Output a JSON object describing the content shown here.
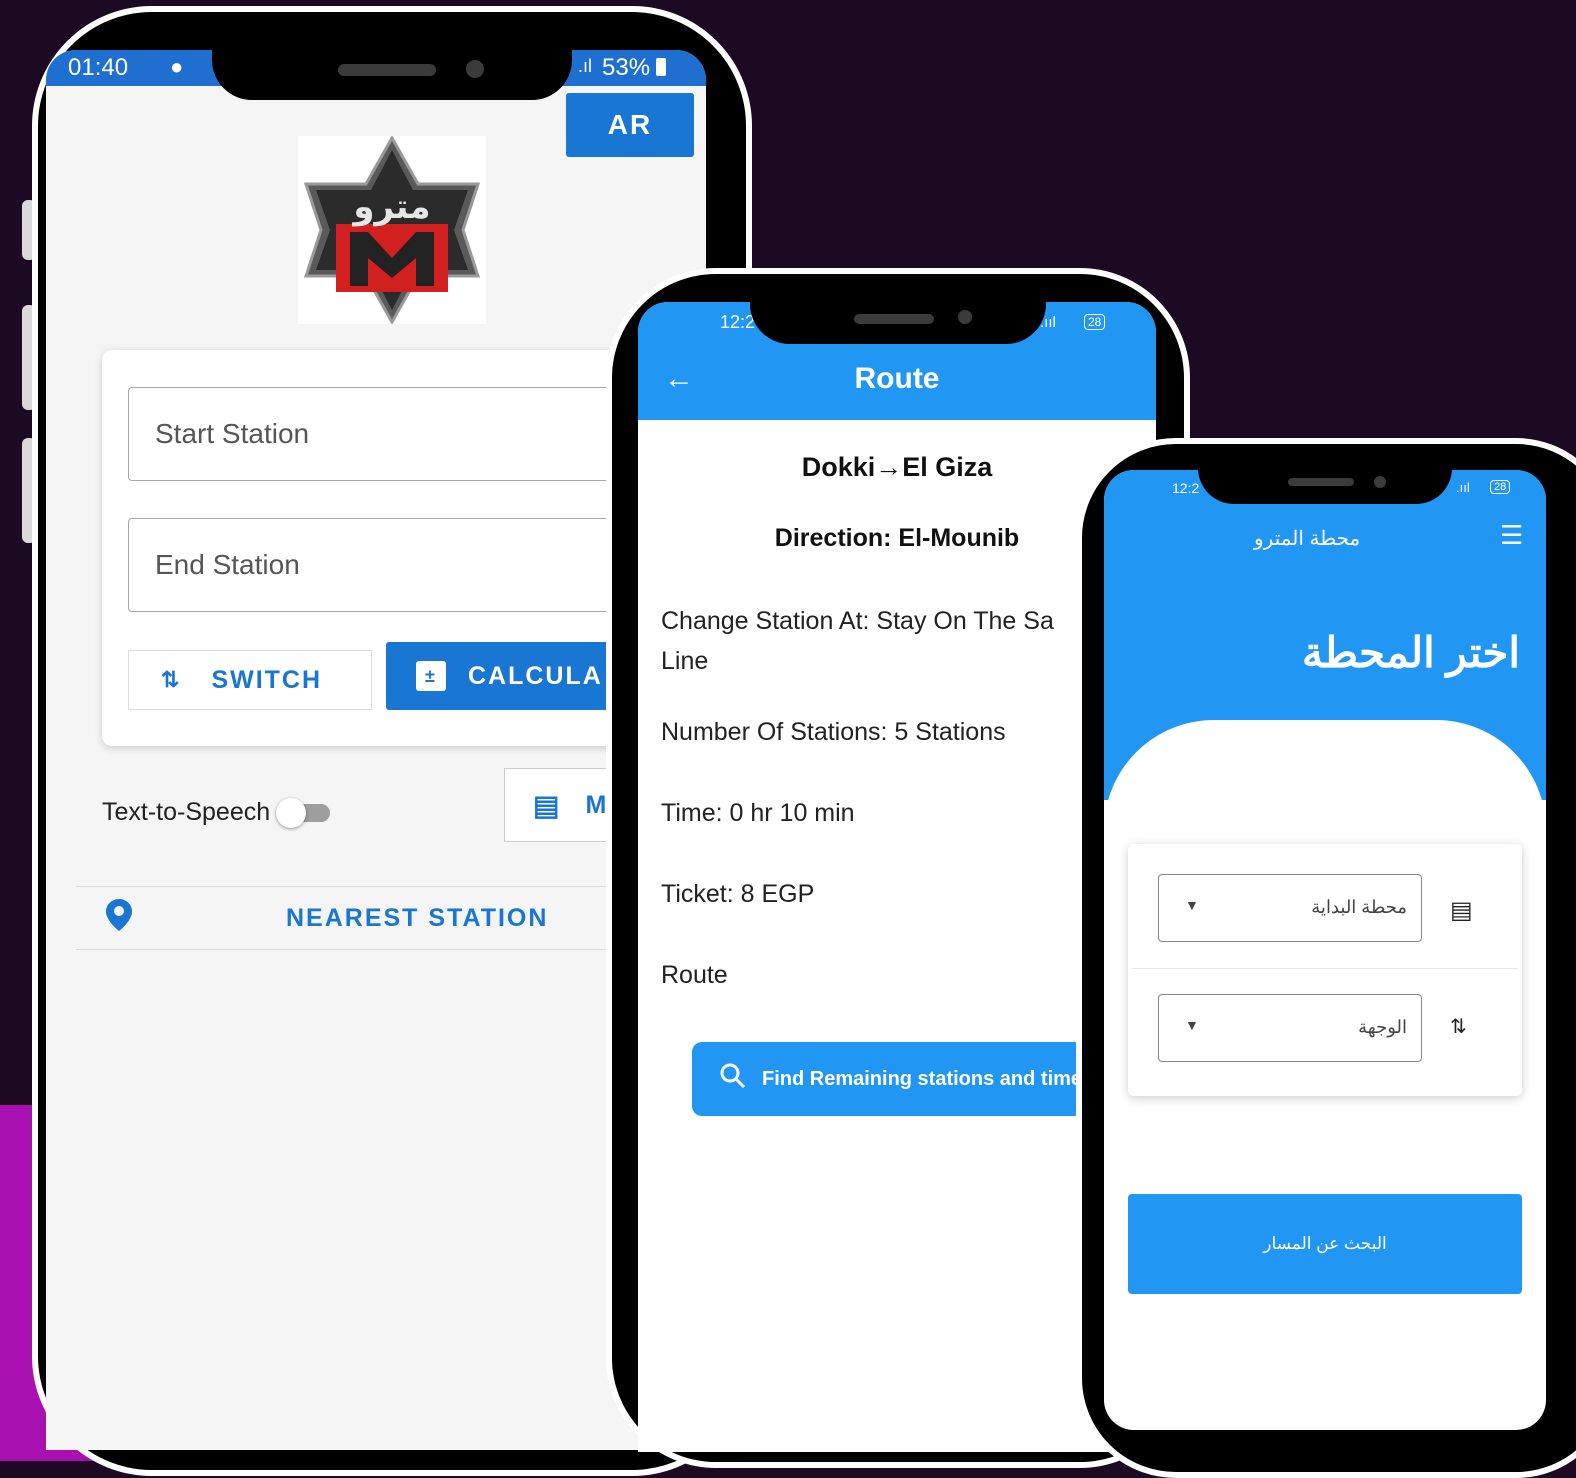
{
  "phone1": {
    "status_time": "01:40",
    "battery": "53%",
    "lang_button": "AR",
    "start_placeholder": "Start Station",
    "end_placeholder": "End Station",
    "switch_label": "SWITCH",
    "calculate_label": "CALCULA",
    "tts_label": "Text-to-Speech",
    "map_label": "M",
    "nearest_label": "NEAREST STATION",
    "logo_text": "مترو"
  },
  "phone2": {
    "status_time": "12:2",
    "battery": "28",
    "title": "Route",
    "stations": "Dokki→El Giza",
    "direction": "Direction: El-Mounib",
    "change_station": "Change Station At: Stay On The Sa",
    "change_station_cont": "Line",
    "num_stations": "Number Of Stations: 5 Stations",
    "time": "Time: 0 hr  10 min",
    "ticket": "Ticket: 8 EGP",
    "route": "Route",
    "find_button": "Find Remaining stations and time"
  },
  "phone3": {
    "status_time": "12:2",
    "battery": "28",
    "app_title": "محطة المترو",
    "heading": "اختر المحطة",
    "start_select": "محطة البداية",
    "dest_select": "الوجهة",
    "search_button": "البحث عن المسار"
  },
  "colors": {
    "primary": "#1976d2",
    "appbar": "#2196f3",
    "background": "#1c0a22",
    "accent": "#a811b0"
  }
}
